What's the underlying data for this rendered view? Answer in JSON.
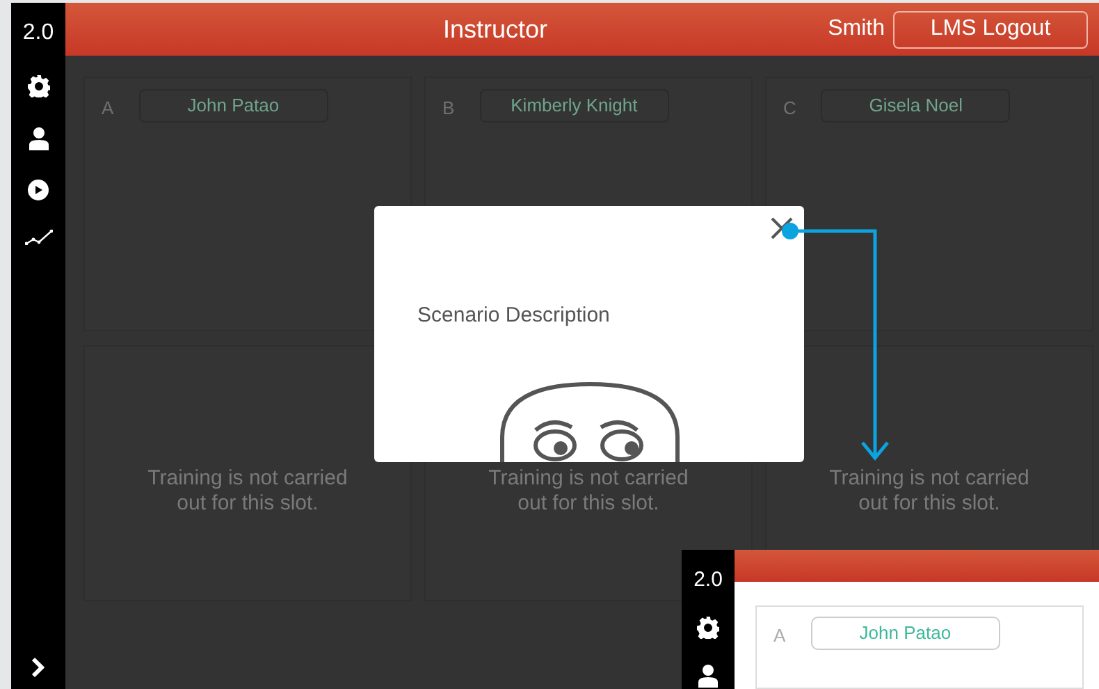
{
  "sidebar": {
    "version": "2.0"
  },
  "header": {
    "title": "Instructor",
    "user": "Smith",
    "logout_button": "LMS Logout"
  },
  "slots": [
    {
      "letter": "A",
      "trainee": "John Patao"
    },
    {
      "letter": "B",
      "trainee": "Kimberly Knight"
    },
    {
      "letter": "C",
      "trainee": "Gisela Noel"
    }
  ],
  "empty_slots": [
    {
      "message": "Training is not carried out for this slot."
    },
    {
      "message": "Training is not carried out for this slot."
    },
    {
      "message": "Training is not carried out for this slot."
    }
  ],
  "modal": {
    "title": "Scenario Description"
  },
  "inset": {
    "version": "2.0",
    "slot": {
      "letter": "A",
      "trainee": "John Patao"
    }
  }
}
